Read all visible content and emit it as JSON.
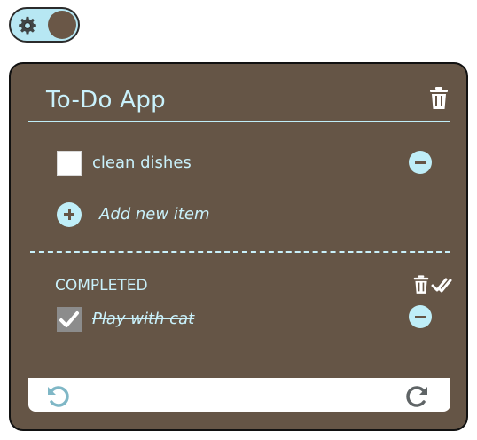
{
  "theme_toggle": {
    "icon": "gear-icon",
    "state": "dark"
  },
  "app": {
    "title": "To-Do App",
    "todo_items": [
      {
        "label": "clean dishes",
        "checked": false
      }
    ],
    "add_item_placeholder": "Add new item",
    "completed": {
      "heading": "COMPLETED",
      "items": [
        {
          "label": "Play with cat",
          "checked": true
        }
      ]
    }
  },
  "colors": {
    "card_background": "#655546",
    "accent": "#bfeef8",
    "toggle_background": "#b7e7f3",
    "undo_icon": "#7fb7c6",
    "redo_icon": "#5f6466"
  }
}
